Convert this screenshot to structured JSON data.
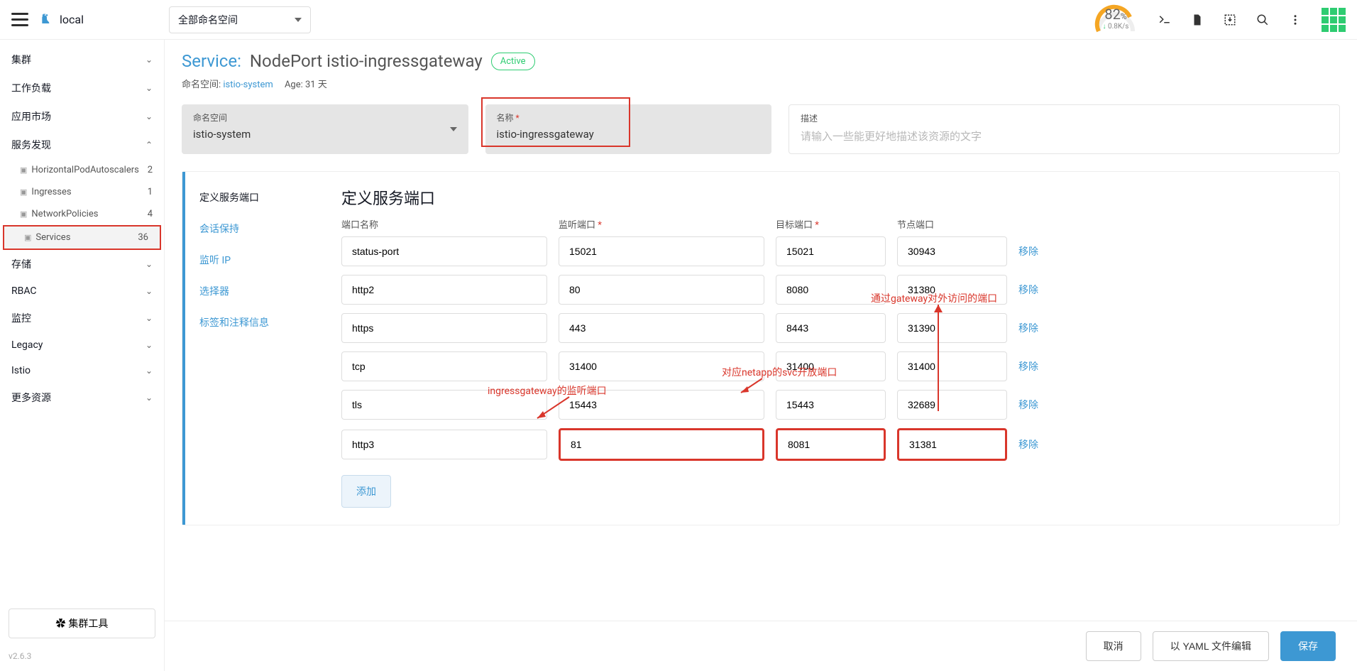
{
  "topbar": {
    "cluster": "local",
    "namespace_selector": "全部命名空间",
    "gauge": {
      "percent": "82",
      "unit": "%",
      "rate_prefix": "↓",
      "rate": "0.8K/s"
    }
  },
  "sidebar": {
    "items": [
      {
        "label": "集群",
        "chev": "⌄"
      },
      {
        "label": "工作负载",
        "chev": "⌄"
      },
      {
        "label": "应用市场",
        "chev": "⌄"
      },
      {
        "label": "服务发现",
        "chev": "⌃",
        "expanded": true
      },
      {
        "label": "存储",
        "chev": "⌄"
      },
      {
        "label": "RBAC",
        "chev": "⌄"
      },
      {
        "label": "监控",
        "chev": "⌄"
      },
      {
        "label": "Legacy",
        "chev": "⌄"
      },
      {
        "label": "Istio",
        "chev": "⌄"
      },
      {
        "label": "更多资源",
        "chev": "⌄"
      }
    ],
    "subs": [
      {
        "label": "HorizontalPodAutoscalers",
        "count": "2"
      },
      {
        "label": "Ingresses",
        "count": "1"
      },
      {
        "label": "NetworkPolicies",
        "count": "4"
      },
      {
        "label": "Services",
        "count": "36",
        "active": true
      }
    ],
    "cluster_tools": "✿  集群工具",
    "version": "v2.6.3"
  },
  "header": {
    "service_label": "Service:",
    "service_name": "NodePort istio-ingressgateway",
    "status": "Active",
    "ns_label": "命名空间:",
    "ns_value": "istio-system",
    "age_label": "Age:",
    "age_value": "31 天"
  },
  "info": {
    "ns_field_label": "命名空间",
    "ns_field_value": "istio-system",
    "name_field_label": "名称",
    "name_field_value": "istio-ingressgateway",
    "desc_field_label": "描述",
    "desc_placeholder": "请输入一些能更好地描述该资源的文字"
  },
  "tabs": {
    "t0": "定义服务端口",
    "t1": "会话保持",
    "t2": "监听 IP",
    "t3": "选择器",
    "t4": "标签和注释信息"
  },
  "panel": {
    "title": "定义服务端口",
    "col_name": "端口名称",
    "col_listen": "监听端口",
    "col_target": "目标端口",
    "col_node": "节点端口",
    "remove": "移除",
    "add": "添加",
    "rows": [
      {
        "name": "status-port",
        "listen": "15021",
        "target": "15021",
        "node": "30943"
      },
      {
        "name": "http2",
        "listen": "80",
        "target": "8080",
        "node": "31380"
      },
      {
        "name": "https",
        "listen": "443",
        "target": "8443",
        "node": "31390"
      },
      {
        "name": "tcp",
        "listen": "31400",
        "target": "31400",
        "node": "31400"
      },
      {
        "name": "tls",
        "listen": "15443",
        "target": "15443",
        "node": "32689"
      },
      {
        "name": "http3",
        "listen": "81",
        "target": "8081",
        "node": "31381"
      }
    ]
  },
  "annotations": {
    "a1": "ingressgateway的监听端口",
    "a2": "对应netapp的svc开放端口",
    "a3": "通过gateway对外访问的端口"
  },
  "footer": {
    "cancel": "取消",
    "yaml": "以 YAML 文件编辑",
    "save": "保存"
  }
}
